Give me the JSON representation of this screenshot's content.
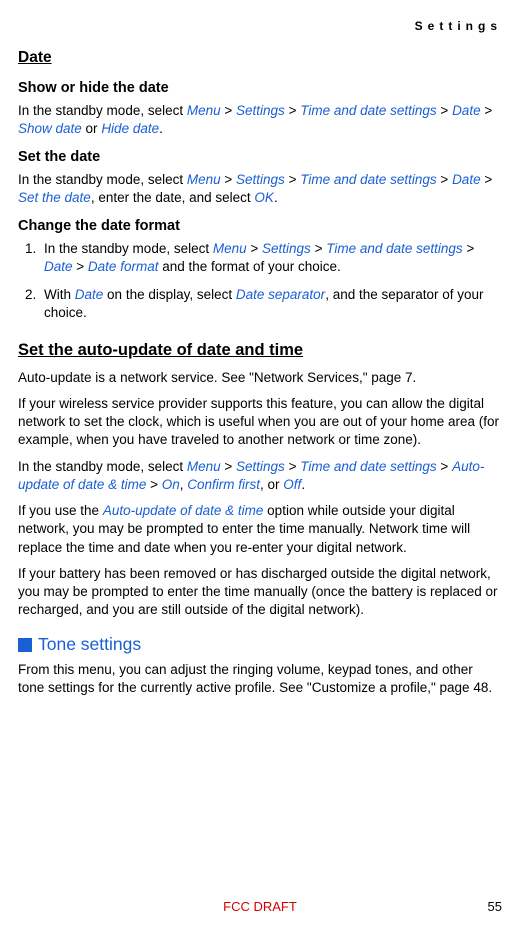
{
  "header": "Settings",
  "date": {
    "title": "Date",
    "showhide": {
      "title": "Show or hide the date",
      "prefix": "In the standby mode, select ",
      "m": "Menu",
      "s": "Settings",
      "t": "Time and date settings",
      "d": "Date",
      "sd": "Show date",
      "or": " or ",
      "hd": "Hide date",
      "end": "."
    },
    "setdate": {
      "title": "Set the date",
      "prefix": "In the standby mode, select ",
      "m": "Menu",
      "s": "Settings",
      "t": "Time and date settings",
      "d": "Date",
      "std": "Set the date",
      "mid": ", enter the date, and select ",
      "ok": "OK",
      "end": "."
    },
    "changefmt": {
      "title": "Change the date format",
      "item1_pre": "In the standby mode, select ",
      "m": "Menu",
      "s": "Settings",
      "t": "Time and date settings",
      "d": "Date",
      "df": "Date format",
      "item1_post": " and the format of your choice.",
      "item2_pre": "With ",
      "item2_d": "Date",
      "item2_mid": " on the display, select ",
      "ds": "Date separator",
      "item2_post": ", and the separator of your choice."
    }
  },
  "auto": {
    "title": "Set the auto-update of date and time",
    "p1": "Auto-update is a network service.  See \"Network Services,\" page 7.",
    "p2": "If your wireless service provider supports this feature, you can allow the digital network to set the clock, which is useful when you are out of your home area (for example, when you have traveled to another network or time zone).",
    "p3_pre": "In the standby mode, select ",
    "m": "Menu",
    "s": "Settings",
    "t": "Time and date settings",
    "au": "Auto-update of date & time",
    "on": "On",
    "cf": "Confirm first",
    "or": ", or ",
    "off": "Off",
    "end": ".",
    "p4_pre": "If you use the ",
    "p4_au": "Auto-update of date & time",
    "p4_post": " option while outside your digital network, you may be prompted to enter the time manually. Network time will replace the time and date when you re-enter your digital network.",
    "p5": "If your battery has been removed or has discharged outside the digital network, you may be prompted to enter the time manually (once the battery is replaced or recharged, and you are still outside of the digital network)."
  },
  "tone": {
    "title": "Tone settings",
    "p1": "From this menu, you can adjust the ringing volume, keypad tones, and other tone settings for the currently active profile.  See \"Customize a profile,\" page 48."
  },
  "footer": "FCC DRAFT",
  "page": "55",
  "gt": " > "
}
